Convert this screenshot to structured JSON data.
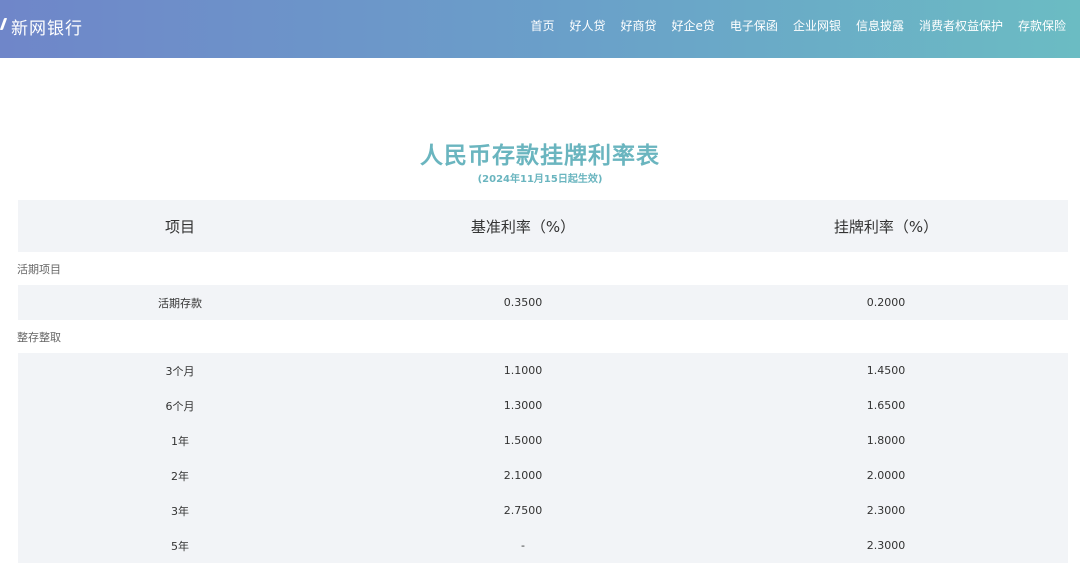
{
  "header": {
    "brand": "新网银行",
    "nav": [
      "首页",
      "好人贷",
      "好商贷",
      "好企e贷",
      "电子保函",
      "企业网银",
      "信息披露",
      "消费者权益保护",
      "存款保险"
    ]
  },
  "page": {
    "title": "人民币存款挂牌利率表",
    "subtitle": "(2024年11月15日起生效)"
  },
  "table": {
    "headers": [
      "项目",
      "基准利率（%）",
      "挂牌利率（%）"
    ],
    "groups": [
      {
        "label": "活期项目",
        "rows": [
          {
            "item": "活期存款",
            "base": "0.3500",
            "listed": "0.2000"
          }
        ]
      },
      {
        "label": "整存整取",
        "rows": [
          {
            "item": "3个月",
            "base": "1.1000",
            "listed": "1.4500"
          },
          {
            "item": "6个月",
            "base": "1.3000",
            "listed": "1.6500"
          },
          {
            "item": "1年",
            "base": "1.5000",
            "listed": "1.8000"
          },
          {
            "item": "2年",
            "base": "2.1000",
            "listed": "2.0000"
          },
          {
            "item": "3年",
            "base": "2.7500",
            "listed": "2.3000"
          },
          {
            "item": "5年",
            "base": "-",
            "listed": "2.3000"
          }
        ]
      }
    ]
  }
}
